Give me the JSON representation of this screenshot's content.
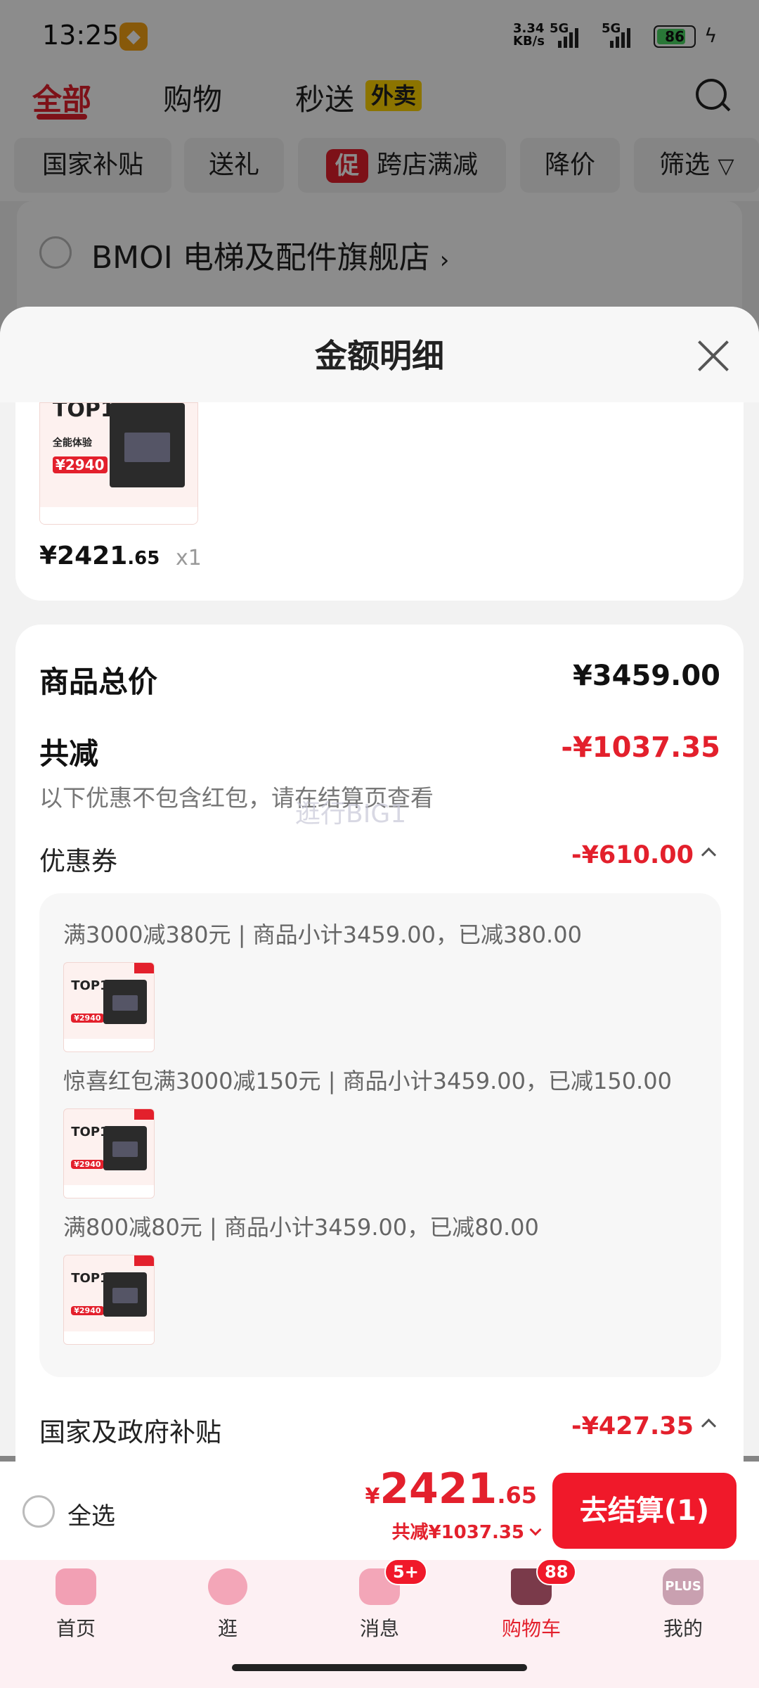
{
  "status_bar": {
    "time": "13:25",
    "net_speed_top": "3.34",
    "net_speed_bottom": "KB/s",
    "sig1": "5G",
    "sig2": "5G",
    "battery": "86"
  },
  "top_tabs": [
    {
      "label": "全部"
    },
    {
      "label": "购物"
    },
    {
      "label": "秒送"
    }
  ],
  "waimai_tag": "外卖",
  "filter_chips": [
    "国家补贴",
    "送礼",
    "跨店满减",
    "降价",
    "筛选"
  ],
  "promo_icon": "促",
  "store": {
    "name": "BMOI 电梯及配件旗舰店",
    "arrow": "›"
  },
  "sheet": {
    "title": "金额明细"
  },
  "product": {
    "thumb_title": "TOP1",
    "thumb_sub": "全能体验",
    "thumb_price": "¥2940",
    "price_int": "¥2421",
    "price_dec": ".65",
    "qty": "x1"
  },
  "summary": {
    "total_label": "商品总价",
    "total_value": "¥3459.00",
    "discount_label": "共减",
    "discount_value": "-¥1037.35",
    "note": "以下优惠不包含红包，请在结算页查看",
    "watermark": "逛行BIG1"
  },
  "coupon": {
    "label": "优惠券",
    "value": "-¥610.00",
    "items": [
      {
        "text": "满3000减380元 | 商品小计3459.00，已减380.00"
      },
      {
        "text": "惊喜红包满3000减150元 | 商品小计3459.00，已减150.00"
      },
      {
        "text": "满800减80元 | 商品小计3459.00，已减80.00"
      }
    ]
  },
  "subsidy": {
    "label": "国家及政府补贴",
    "value": "-¥427.35"
  },
  "checkout": {
    "select_all": "全选",
    "currency": "¥",
    "total_int": "2421",
    "total_dec": ".65",
    "saved": "共减¥1037.35",
    "pay_button": "去结算(1)"
  },
  "bottom_nav": [
    {
      "label": "首页",
      "icon": "home-icon"
    },
    {
      "label": "逛",
      "icon": "browse-icon"
    },
    {
      "label": "消息",
      "icon": "message-icon",
      "badge": "5+"
    },
    {
      "label": "购物车",
      "icon": "cart-icon",
      "badge": "88"
    },
    {
      "label": "我的",
      "icon": "plus-icon",
      "icon_text": "PLUS"
    }
  ],
  "colors": {
    "accent": "#e3202c",
    "pay_button": "#f0192a",
    "waimai": "#ffd400"
  }
}
